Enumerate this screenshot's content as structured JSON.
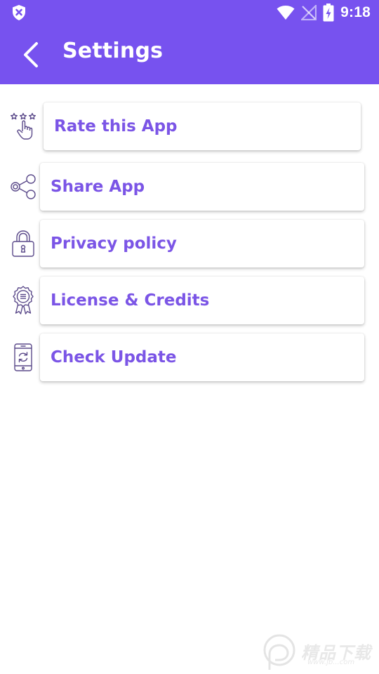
{
  "status_bar": {
    "time": "9:18",
    "left_icon": "shield-x-icon",
    "icons": [
      "wifi-icon",
      "no-signal-icon",
      "battery-charging-icon"
    ]
  },
  "header": {
    "title": "Settings",
    "back_icon": "chevron-left-icon",
    "background_color": "#7752ef"
  },
  "settings": {
    "items": [
      {
        "label": "Rate this App",
        "icon": "rate-stars-tap-icon"
      },
      {
        "label": "Share App",
        "icon": "share-nodes-icon"
      },
      {
        "label": "Privacy policy",
        "icon": "padlock-icon"
      },
      {
        "label": "License & Credits",
        "icon": "award-badge-icon"
      },
      {
        "label": "Check Update",
        "icon": "phone-refresh-icon"
      }
    ],
    "label_color": "#7b55e6"
  },
  "watermark": {
    "text": "精品下载",
    "sub": "www.jb...com"
  }
}
